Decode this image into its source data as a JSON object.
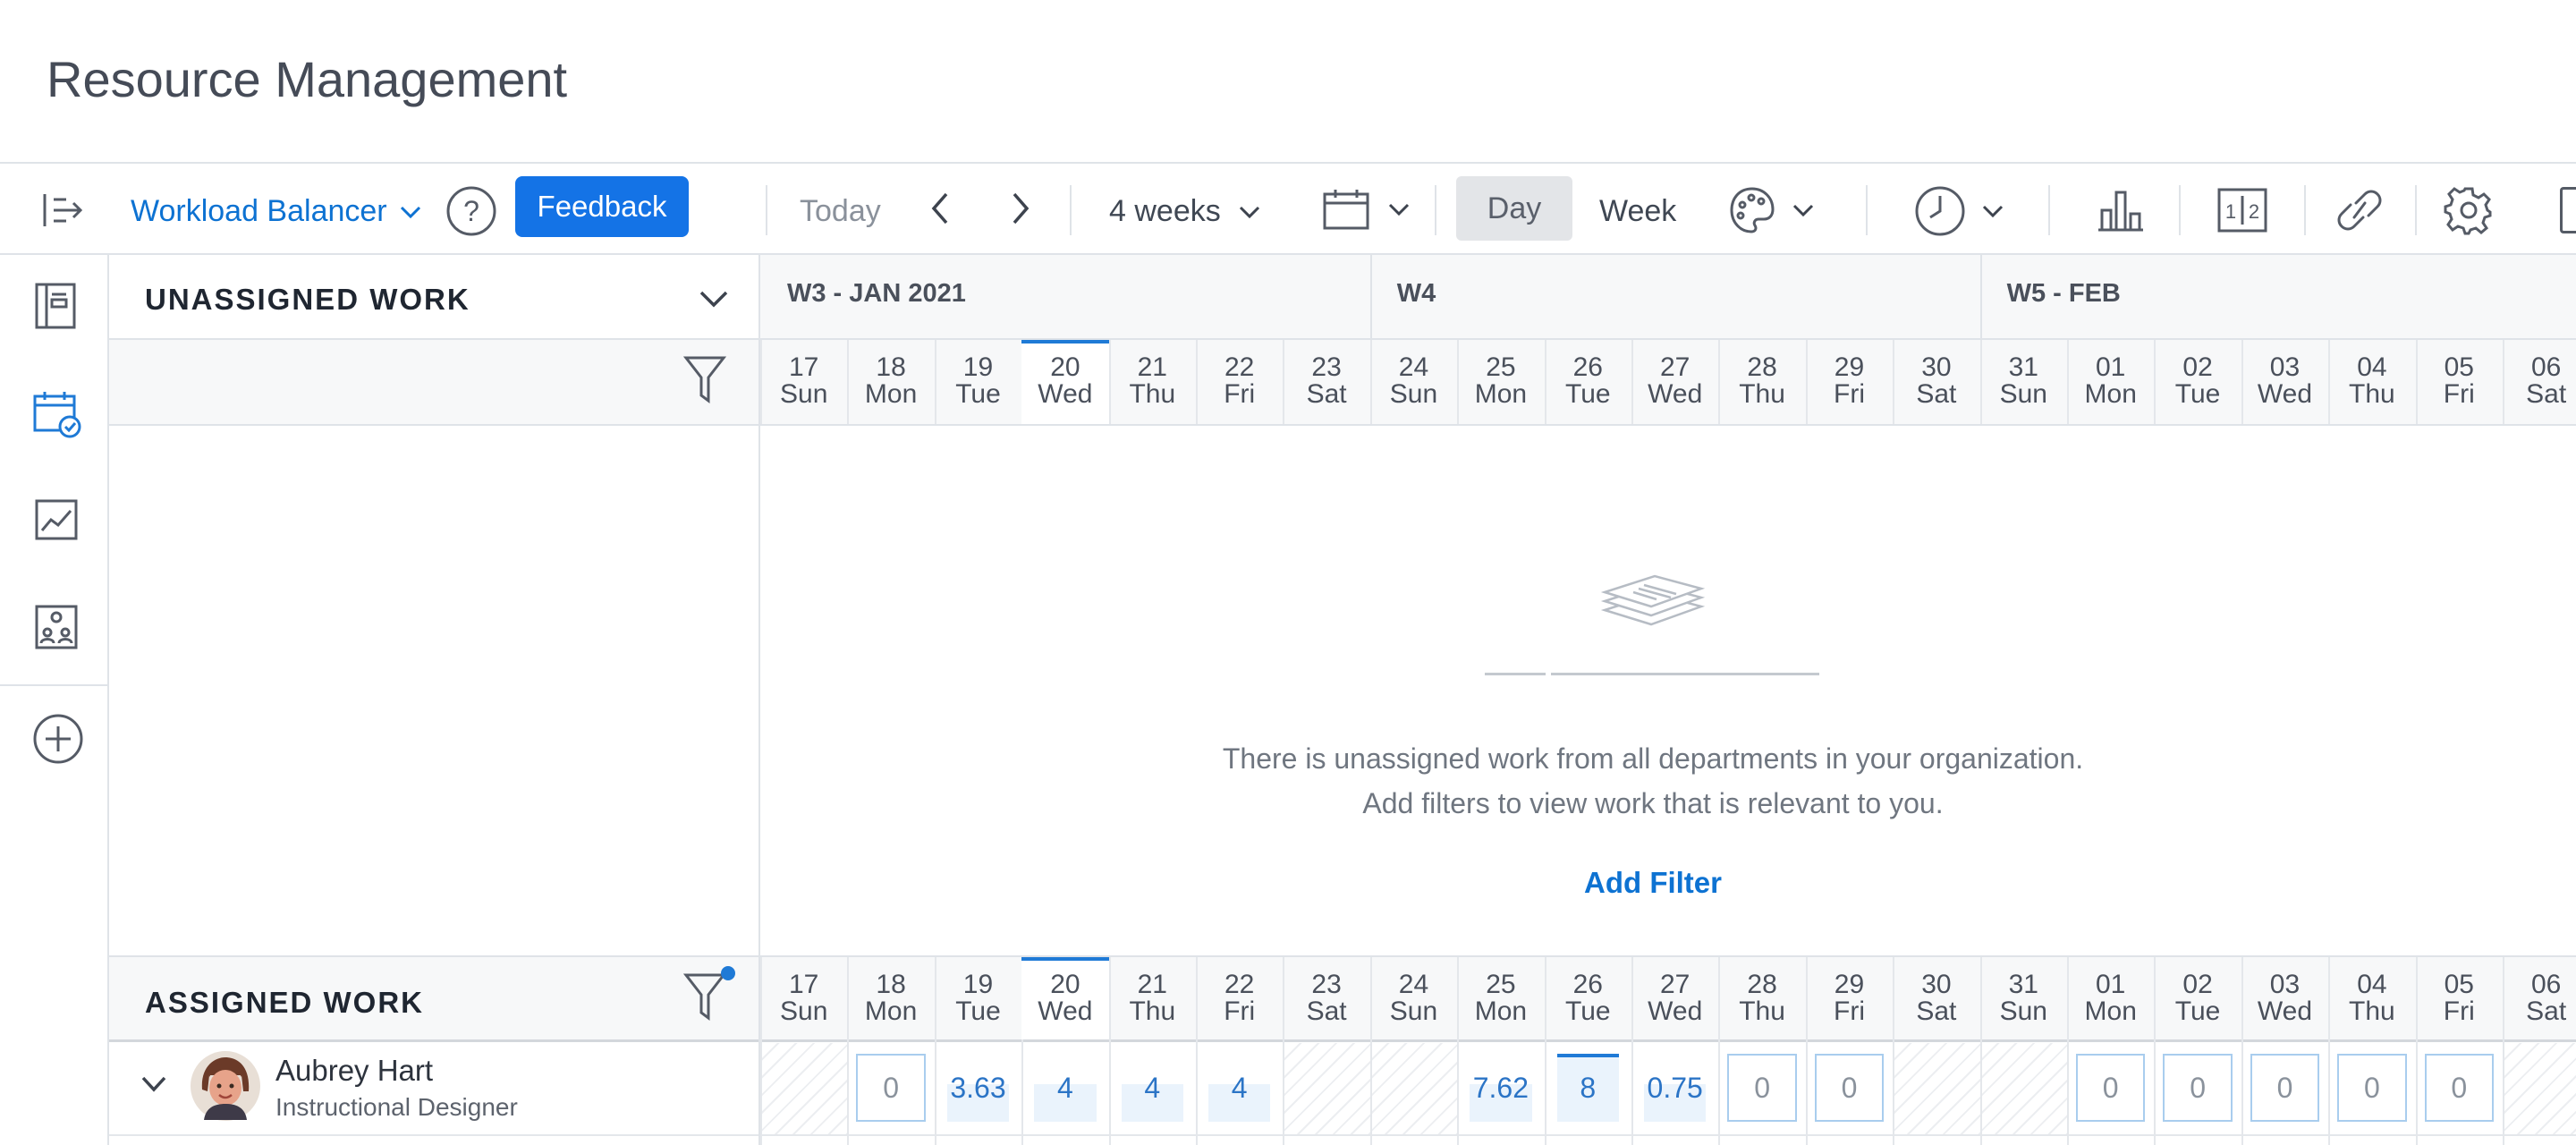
{
  "page": {
    "title": "Resource Management"
  },
  "toolbar": {
    "view_label": "Workload Balancer",
    "feedback_label": "Feedback",
    "today_label": "Today",
    "range_label": "4 weeks",
    "day_label": "Day",
    "week_label": "Week"
  },
  "sidebar": {
    "items": [
      "project-list",
      "workload-calendar",
      "line-chart",
      "team-directory",
      "add"
    ],
    "active": "workload-calendar"
  },
  "timeline": {
    "weeks": [
      "W3 - JAN 2021",
      "W4",
      "W5 - FEB"
    ],
    "days": [
      {
        "num": "17",
        "dow": "Sun"
      },
      {
        "num": "18",
        "dow": "Mon"
      },
      {
        "num": "19",
        "dow": "Tue"
      },
      {
        "num": "20",
        "dow": "Wed"
      },
      {
        "num": "21",
        "dow": "Thu"
      },
      {
        "num": "22",
        "dow": "Fri"
      },
      {
        "num": "23",
        "dow": "Sat"
      },
      {
        "num": "24",
        "dow": "Sun"
      },
      {
        "num": "25",
        "dow": "Mon"
      },
      {
        "num": "26",
        "dow": "Tue"
      },
      {
        "num": "27",
        "dow": "Wed"
      },
      {
        "num": "28",
        "dow": "Thu"
      },
      {
        "num": "29",
        "dow": "Fri"
      },
      {
        "num": "30",
        "dow": "Sat"
      },
      {
        "num": "31",
        "dow": "Sun"
      },
      {
        "num": "01",
        "dow": "Mon"
      },
      {
        "num": "02",
        "dow": "Tue"
      },
      {
        "num": "03",
        "dow": "Wed"
      },
      {
        "num": "04",
        "dow": "Thu"
      },
      {
        "num": "05",
        "dow": "Fri"
      },
      {
        "num": "06",
        "dow": "Sat"
      }
    ],
    "today_index": 3
  },
  "unassigned": {
    "title": "UNASSIGNED WORK",
    "empty_line1": "There is unassigned work from all departments in your organization.",
    "empty_line2": "Add filters to view work that is relevant to you.",
    "add_filter_label": "Add Filter"
  },
  "assigned": {
    "title": "ASSIGNED WORK",
    "people": [
      {
        "name": "Aubrey Hart",
        "role": "Instructional Designer",
        "cells": [
          {
            "v": null,
            "s": "off"
          },
          {
            "v": "0",
            "s": "box"
          },
          {
            "v": "3.63",
            "s": "fill"
          },
          {
            "v": "4",
            "s": "fill"
          },
          {
            "v": "4",
            "s": "fill"
          },
          {
            "v": "4",
            "s": "fill"
          },
          {
            "v": null,
            "s": "off"
          },
          {
            "v": null,
            "s": "off"
          },
          {
            "v": "7.62",
            "s": "fill"
          },
          {
            "v": "8",
            "s": "full"
          },
          {
            "v": "0.75",
            "s": "fill"
          },
          {
            "v": "0",
            "s": "box"
          },
          {
            "v": "0",
            "s": "box"
          },
          {
            "v": null,
            "s": "off"
          },
          {
            "v": null,
            "s": "off"
          },
          {
            "v": "0",
            "s": "box"
          },
          {
            "v": "0",
            "s": "box"
          },
          {
            "v": "0",
            "s": "box"
          },
          {
            "v": "0",
            "s": "box"
          },
          {
            "v": "0",
            "s": "box"
          },
          {
            "v": null,
            "s": "off"
          }
        ]
      }
    ]
  },
  "colors": {
    "accent": "#0d72d2",
    "feedback_bg": "#1473e6",
    "cell_border": "#a9cdee",
    "cell_fill": "#eaf3fc"
  }
}
